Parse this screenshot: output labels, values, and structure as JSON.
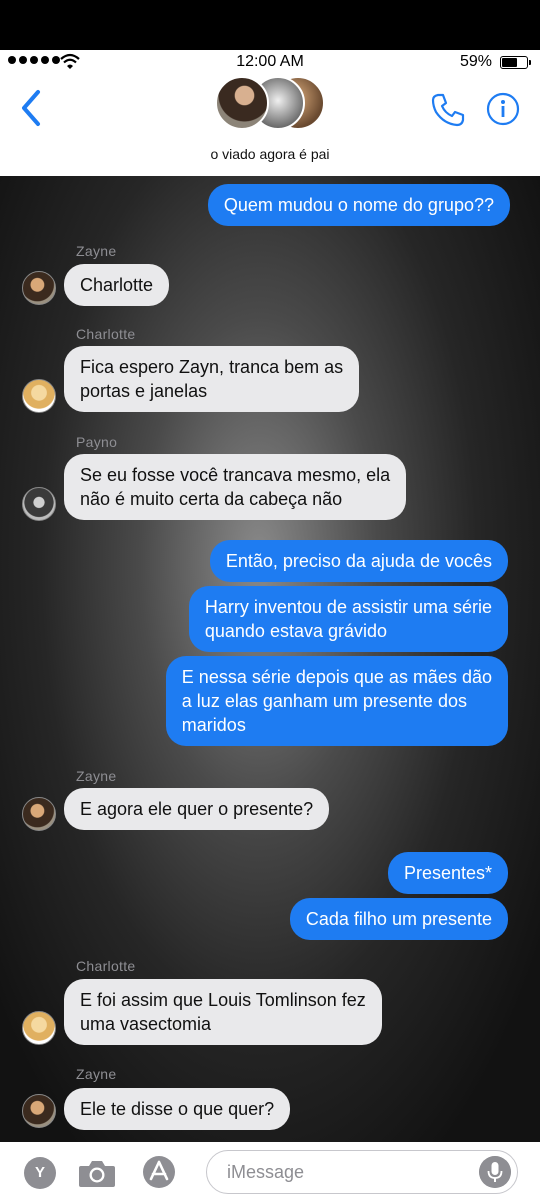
{
  "status_bar": {
    "time": "12:00 AM",
    "battery": "59%"
  },
  "header": {
    "group_name": "o viado agora é pai"
  },
  "messages": [
    {
      "text": "Quem mudou o nome do grupo??"
    },
    {
      "sender": "Zayne",
      "text": "Charlotte"
    },
    {
      "sender": "Charlotte",
      "text": "Fica espero Zayn, tranca bem as\nportas e janelas"
    },
    {
      "sender": "Payno",
      "text": "Se eu fosse você trancava mesmo, ela\nnão é muito certa da cabeça não"
    },
    {
      "text": "Então, preciso da ajuda de vocês"
    },
    {
      "text": "Harry inventou de assistir uma série\nquando estava grávido"
    },
    {
      "text": "E nessa série depois que as mães dão\na luz elas ganham um presente dos\nmaridos"
    },
    {
      "sender": "Zayne",
      "text": "E agora ele quer o presente?"
    },
    {
      "text": "Presentes*"
    },
    {
      "text": "Cada filho um presente"
    },
    {
      "sender": "Charlotte",
      "text": "E foi assim que Louis Tomlinson fez\numa vasectomia"
    },
    {
      "sender": "Zayne",
      "text": "Ele te disse o que quer?"
    }
  ],
  "compose": {
    "app_letter": "Y",
    "placeholder": "iMessage"
  },
  "icons": [
    "wifi-icon",
    "back-chevron-icon",
    "phone-icon",
    "info-icon",
    "camera-icon",
    "app-store-icon",
    "microphone-icon"
  ],
  "colors": {
    "sent_bubble": "#1e7cf2",
    "received_bubble": "#e9e9eb",
    "ios_blue": "#1e7cf2"
  }
}
